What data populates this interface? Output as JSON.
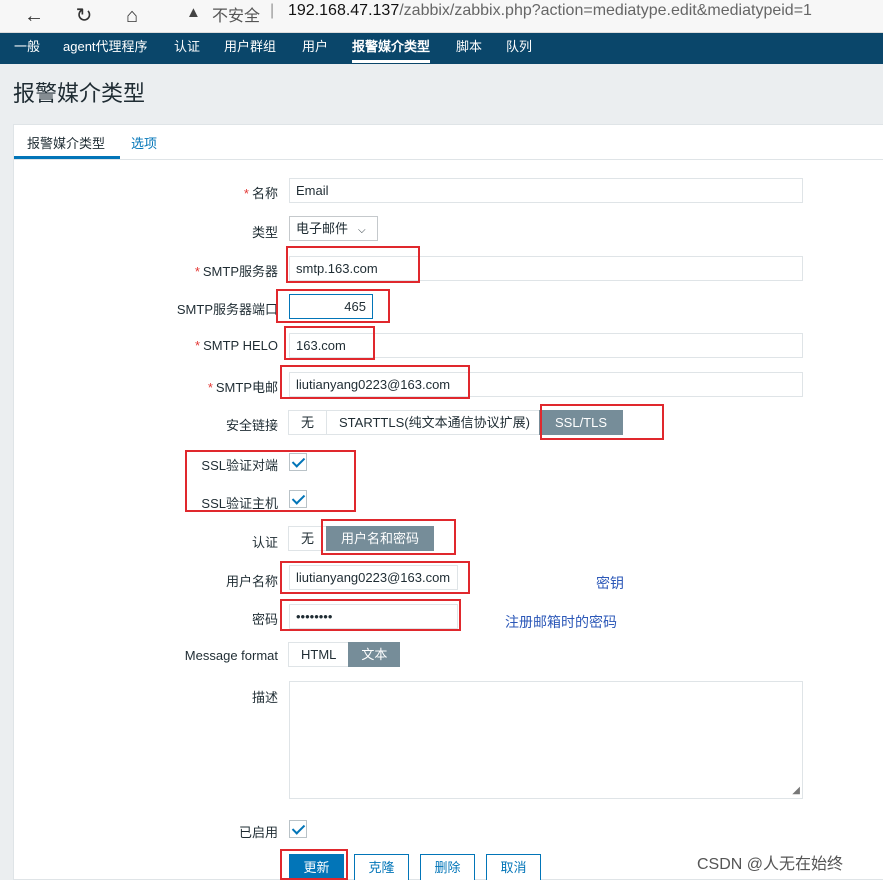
{
  "browser": {
    "back_icon": "←",
    "reload_icon": "↻",
    "home_icon": "⌂",
    "warning_icon": "▲",
    "insecure_label": "不安全",
    "separator": "|",
    "url_host": "192.168.47.137",
    "url_path": "/zabbix/zabbix.php?action=mediatype.edit&mediatypeid=1"
  },
  "nav": {
    "items": [
      "一般",
      "agent代理程序",
      "认证",
      "用户群组",
      "用户",
      "报警媒介类型",
      "脚本",
      "队列"
    ],
    "active": "报警媒介类型"
  },
  "page": {
    "title": "报警媒介类型"
  },
  "tabs": {
    "media_type": "报警媒介类型",
    "options": "选项"
  },
  "form": {
    "name_label": "名称",
    "name_value": "Email",
    "type_label": "类型",
    "type_value": "电子邮件",
    "smtp_server_label": "SMTP服务器",
    "smtp_server_value": "smtp.163.com",
    "smtp_port_label": "SMTP服务器端口",
    "smtp_port_value": "465",
    "smtp_helo_label": "SMTP HELO",
    "smtp_helo_value": "163.com",
    "smtp_email_label": "SMTP电邮",
    "smtp_email_value": "liutianyang0223@163.com",
    "security_label": "安全链接",
    "security_options": [
      "无",
      "STARTTLS(纯文本通信协议扩展)",
      "SSL/TLS"
    ],
    "security_selected": "SSL/TLS",
    "ssl_peer_label": "SSL验证对端",
    "ssl_peer_checked": true,
    "ssl_host_label": "SSL验证主机",
    "ssl_host_checked": true,
    "auth_label": "认证",
    "auth_options": [
      "无",
      "用户名和密码"
    ],
    "auth_selected": "用户名和密码",
    "username_label": "用户名称",
    "username_value": "liutianyang0223@163.com",
    "password_label": "密码",
    "password_value": "••••••••",
    "format_label": "Message format",
    "format_options": [
      "HTML",
      "文本"
    ],
    "format_selected": "文本",
    "description_label": "描述",
    "description_value": "",
    "enabled_label": "已启用",
    "enabled_checked": true,
    "required_mark": "*"
  },
  "buttons": {
    "update": "更新",
    "clone": "克隆",
    "delete": "删除",
    "cancel": "取消"
  },
  "annotations": {
    "secret_key": "密钥",
    "password_note": "注册邮箱时的密码"
  },
  "watermark": "CSDN @人无在始终",
  "colors": {
    "nav_bg": "#0a466a",
    "accent": "#0275b8",
    "annotation": "#e0282d",
    "note_text": "#2c58b8"
  }
}
